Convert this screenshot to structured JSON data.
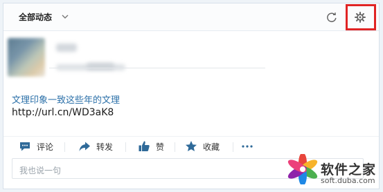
{
  "header": {
    "filter_label": "全部动态"
  },
  "post": {
    "title": "文理印象一致这些年的文理",
    "link": "http://url.cn/WD3aK8"
  },
  "actions": [
    {
      "label": "评论",
      "icon": "comment-icon"
    },
    {
      "label": "转发",
      "icon": "share-icon"
    },
    {
      "label": "赞",
      "icon": "thumbs-up-icon"
    },
    {
      "label": "收藏",
      "icon": "star-icon"
    },
    {
      "label": "",
      "icon": "more-icon"
    }
  ],
  "comment": {
    "placeholder": "我也说一句"
  },
  "watermark": {
    "title": "软件之家",
    "url": "soft.duba.com"
  },
  "colors": {
    "link": "#2a6fa8",
    "accent_icon": "#2f6a99",
    "highlight": "#e02424"
  }
}
